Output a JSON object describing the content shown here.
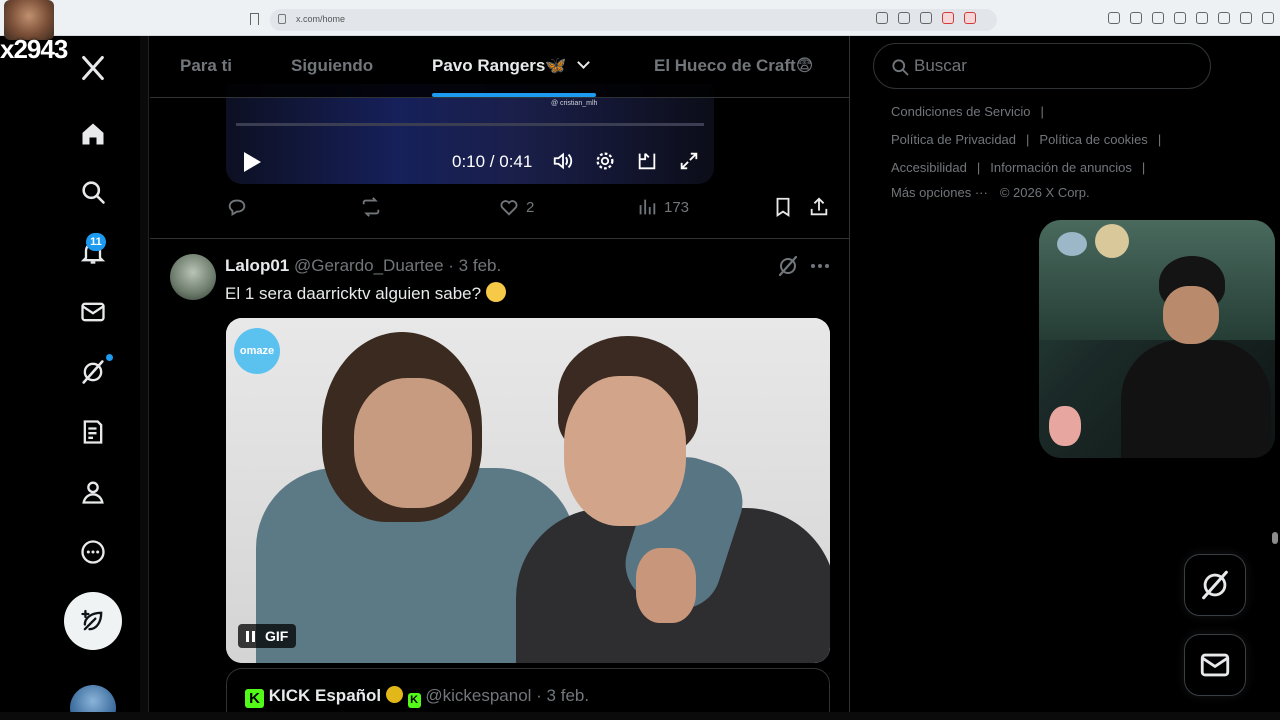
{
  "browser": {
    "url": "x.com/home"
  },
  "stream_overlay": {
    "username": "x2943"
  },
  "nav": {
    "notifications_badge": "11"
  },
  "tabs": [
    {
      "label": "Para ti",
      "active": false
    },
    {
      "label": "Siguiendo",
      "active": false
    },
    {
      "label": "Pavo Rangers🦋",
      "active": true
    },
    {
      "label": "El Hueco de Craft😨",
      "active": false
    }
  ],
  "previous_tweet": {
    "video": {
      "overlay_tag": "@ cristian_mlh",
      "time": "0:10 / 0:41"
    },
    "actions": {
      "likes": "2",
      "views": "173"
    }
  },
  "tweet": {
    "display_name": "Lalop01",
    "handle": "@Gerardo_Duartee",
    "date": "· 3 feb.",
    "text": "El 1 sera daarricktv alguien sabe?",
    "media": {
      "logo": "omaze",
      "gif_label": "GIF"
    },
    "quote": {
      "display_name": "KICK Español",
      "handle": "@kickespanol",
      "date": "· 3 feb."
    }
  },
  "sidebar": {
    "search_placeholder": "Buscar",
    "footer_links": [
      "Condiciones de Servicio",
      "Política de Privacidad",
      "Política de cookies",
      "Accesibilidad",
      "Información de anuncios",
      "Más opciones ···"
    ],
    "copyright": "© 2026 X Corp."
  },
  "colors": {
    "accent": "#1d9bf0",
    "background": "#000000",
    "muted_text": "#71767b",
    "kick_green": "#53fc18"
  },
  "icons": {
    "nav": [
      "x-logo-icon",
      "home-icon",
      "search-icon",
      "bell-icon",
      "mail-icon",
      "grok-icon",
      "lists-icon",
      "profile-icon",
      "more-circle-icon",
      "compose-icon"
    ]
  }
}
